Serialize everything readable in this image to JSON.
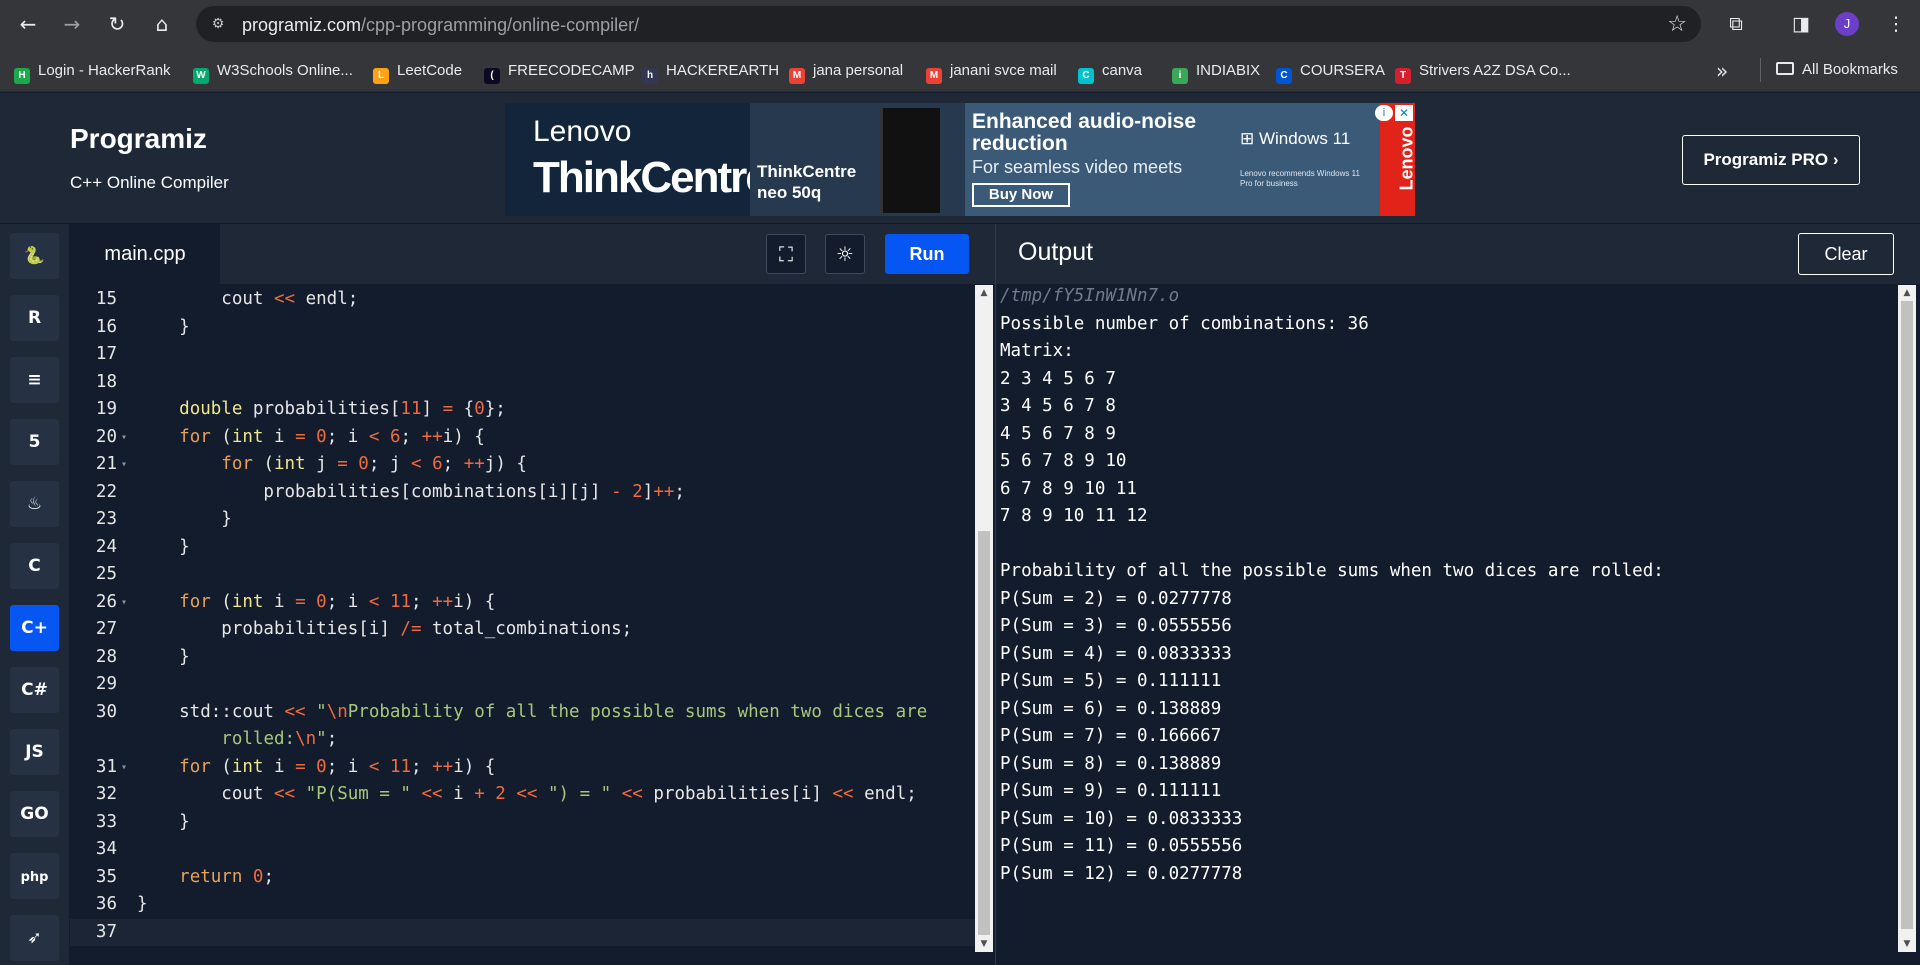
{
  "browser": {
    "url_host": "programiz.com",
    "url_path": "/cpp-programming/online-compiler/",
    "avatar_letter": "J"
  },
  "bookmarks": [
    {
      "label": "Login - HackerRank",
      "icon": "hackerrank-icon",
      "icon_text": "H",
      "color": "#1ba94c"
    },
    {
      "label": "W3Schools Online...",
      "icon": "w3schools-icon",
      "icon_text": "W",
      "color": "#04aa6d"
    },
    {
      "label": "LeetCode",
      "icon": "leetcode-icon",
      "icon_text": "L",
      "color": "#ffa116"
    },
    {
      "label": "FREECODECAMP",
      "icon": "freecodecamp-icon",
      "icon_text": "(A)",
      "color": "#0a0a23"
    },
    {
      "label": "HACKEREARTH",
      "icon": "hackerearth-icon",
      "icon_text": "h",
      "color": "#323754"
    },
    {
      "label": "jana personal",
      "icon": "gmail-icon",
      "icon_text": "M",
      "color": "#ea4335"
    },
    {
      "label": "janani svce mail",
      "icon": "gmail-icon",
      "icon_text": "M",
      "color": "#ea4335"
    },
    {
      "label": "canva",
      "icon": "canva-icon",
      "icon_text": "C",
      "color": "#00c4cc"
    },
    {
      "label": "INDIABIX",
      "icon": "indiabix-icon",
      "icon_text": "i",
      "color": "#3aa757"
    },
    {
      "label": "COURSERA",
      "icon": "coursera-icon",
      "icon_text": "C",
      "color": "#0056d2"
    },
    {
      "label": "Strivers A2Z DSA Co...",
      "icon": "takeuforward-icon",
      "icon_text": "TUF",
      "color": "#d41f2d"
    }
  ],
  "all_bookmarks": "All Bookmarks",
  "site": {
    "logo": "Programiz",
    "subtitle": "C++ Online Compiler",
    "pro_button": "Programiz PRO ›"
  },
  "ad": {
    "brand": "Lenovo",
    "product": "ThinkCentre",
    "device_name_1": "ThinkCentre",
    "device_name_2": "neo 50q",
    "headline": "Enhanced audio-noise reduction",
    "subline": "For seamless video meets",
    "button": "Buy Now",
    "windows": "Windows 11",
    "windows_note": "Lenovo recommends Windows 11 Pro for business",
    "side_brand": "Lenovo"
  },
  "editor": {
    "file_name": "main.cpp",
    "run_label": "Run",
    "lines": [
      {
        "n": "15",
        "fold": "",
        "html": "        cout <span class=\"op\">&lt;&lt;</span> endl;"
      },
      {
        "n": "16",
        "fold": "",
        "html": "    }"
      },
      {
        "n": "17",
        "fold": "",
        "html": ""
      },
      {
        "n": "18",
        "fold": "",
        "html": ""
      },
      {
        "n": "19",
        "fold": "",
        "html": "    <span class=\"kw\">double</span> probabilities[<span class=\"num\">11</span>] <span class=\"op\">=</span> {<span class=\"num\">0</span>};"
      },
      {
        "n": "20",
        "fold": "▾",
        "html": "    <span class=\"kw2\">for</span> (<span class=\"kw\">int</span> i <span class=\"op\">=</span> <span class=\"num\">0</span>; i <span class=\"op\">&lt;</span> <span class=\"num\">6</span>; <span class=\"op\">++</span>i) {"
      },
      {
        "n": "21",
        "fold": "▾",
        "html": "        <span class=\"kw2\">for</span> (<span class=\"kw\">int</span> j <span class=\"op\">=</span> <span class=\"num\">0</span>; j <span class=\"op\">&lt;</span> <span class=\"num\">6</span>; <span class=\"op\">++</span>j) {"
      },
      {
        "n": "22",
        "fold": "",
        "html": "            probabilities[combinations[i][j] <span class=\"op\">-</span> <span class=\"num\">2</span>]<span class=\"op\">++</span>;"
      },
      {
        "n": "23",
        "fold": "",
        "html": "        }"
      },
      {
        "n": "24",
        "fold": "",
        "html": "    }"
      },
      {
        "n": "25",
        "fold": "",
        "html": ""
      },
      {
        "n": "26",
        "fold": "▾",
        "html": "    <span class=\"kw2\">for</span> (<span class=\"kw\">int</span> i <span class=\"op\">=</span> <span class=\"num\">0</span>; i <span class=\"op\">&lt;</span> <span class=\"num\">11</span>; <span class=\"op\">++</span>i) {"
      },
      {
        "n": "27",
        "fold": "",
        "html": "        probabilities[i] <span class=\"op\">/=</span> total_combinations;"
      },
      {
        "n": "28",
        "fold": "",
        "html": "    }"
      },
      {
        "n": "29",
        "fold": "",
        "html": ""
      },
      {
        "n": "30",
        "fold": "",
        "html": "    std::cout <span class=\"op\">&lt;&lt;</span> <span class=\"str\">\"<span class=\"esc\">\\n</span>Probability of all the possible sums when two dices are</span>"
      },
      {
        "n": "",
        "fold": "",
        "html": "        <span class=\"str\">rolled:<span class=\"esc\">\\n</span>\"</span>;"
      },
      {
        "n": "31",
        "fold": "▾",
        "html": "    <span class=\"kw2\">for</span> (<span class=\"kw\">int</span> i <span class=\"op\">=</span> <span class=\"num\">0</span>; i <span class=\"op\">&lt;</span> <span class=\"num\">11</span>; <span class=\"op\">++</span>i) {"
      },
      {
        "n": "32",
        "fold": "",
        "html": "        cout <span class=\"op\">&lt;&lt;</span> <span class=\"str\">\"P(Sum = \"</span> <span class=\"op\">&lt;&lt;</span> i <span class=\"op\">+</span> <span class=\"num\">2</span> <span class=\"op\">&lt;&lt;</span> <span class=\"str\">\") = \"</span> <span class=\"op\">&lt;&lt;</span> probabilities[i] <span class=\"op\">&lt;&lt;</span> endl;"
      },
      {
        "n": "33",
        "fold": "",
        "html": "    }"
      },
      {
        "n": "34",
        "fold": "",
        "html": ""
      },
      {
        "n": "35",
        "fold": "",
        "html": "    <span class=\"kw2\">return</span> <span class=\"num\">0</span>;"
      },
      {
        "n": "36",
        "fold": "",
        "html": "}"
      },
      {
        "n": "37",
        "fold": "",
        "html": "",
        "current": true
      }
    ]
  },
  "output": {
    "title": "Output",
    "clear_label": "Clear",
    "lines": [
      "/tmp/fY5InW1Nn7.o",
      "Possible number of combinations: 36",
      "Matrix:",
      "2 3 4 5 6 7",
      "3 4 5 6 7 8",
      "4 5 6 7 8 9",
      "5 6 7 8 9 10",
      "6 7 8 9 10 11",
      "7 8 9 10 11 12",
      "",
      "Probability of all the possible sums when two dices are rolled:",
      "P(Sum = 2) = 0.0277778",
      "P(Sum = 3) = 0.0555556",
      "P(Sum = 4) = 0.0833333",
      "P(Sum = 5) = 0.111111",
      "P(Sum = 6) = 0.138889",
      "P(Sum = 7) = 0.166667",
      "P(Sum = 8) = 0.138889",
      "P(Sum = 9) = 0.111111",
      "P(Sum = 10) = 0.0833333",
      "P(Sum = 11) = 0.0555556",
      "P(Sum = 12) = 0.0277778"
    ]
  },
  "languages": [
    {
      "name": "python",
      "icon": "python-icon",
      "glyph": "🐍",
      "active": false
    },
    {
      "name": "r",
      "icon": "r-icon",
      "glyph": "R",
      "active": false
    },
    {
      "name": "sql",
      "icon": "database-icon",
      "glyph": "≡",
      "active": false
    },
    {
      "name": "html",
      "icon": "html5-icon",
      "glyph": "5",
      "active": false
    },
    {
      "name": "java",
      "icon": "java-icon",
      "glyph": "♨",
      "active": false
    },
    {
      "name": "c",
      "icon": "c-icon",
      "glyph": "C",
      "active": false
    },
    {
      "name": "cpp",
      "icon": "cpp-icon",
      "glyph": "C+",
      "active": true
    },
    {
      "name": "csharp",
      "icon": "csharp-icon",
      "glyph": "C#",
      "active": false
    },
    {
      "name": "javascript",
      "icon": "javascript-icon",
      "glyph": "JS",
      "active": false
    },
    {
      "name": "go",
      "icon": "go-icon",
      "glyph": "GO",
      "active": false
    },
    {
      "name": "php",
      "icon": "php-icon",
      "glyph": "php",
      "active": false
    },
    {
      "name": "swift",
      "icon": "swift-icon",
      "glyph": "➶",
      "active": false
    }
  ]
}
